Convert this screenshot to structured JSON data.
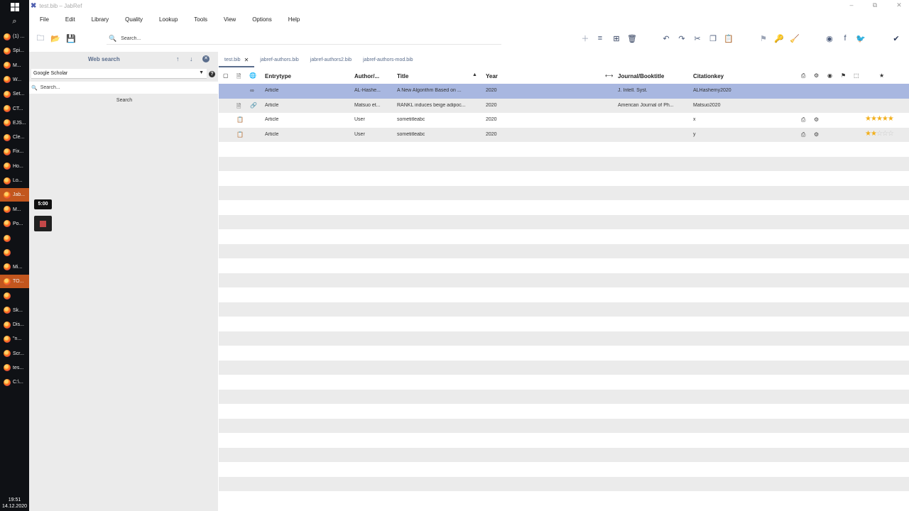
{
  "window": {
    "title": "test.bib – JabRef",
    "app_icon": "jabref-logo-icon"
  },
  "taskbar": {
    "items": [
      {
        "label": "(1) ..."
      },
      {
        "label": "Spi..."
      },
      {
        "label": "M..."
      },
      {
        "label": "W..."
      },
      {
        "label": "Set..."
      },
      {
        "label": "CT..."
      },
      {
        "label": "EJS..."
      },
      {
        "label": "Cle..."
      },
      {
        "label": "Fix..."
      },
      {
        "label": "Ho..."
      },
      {
        "label": "Lo..."
      },
      {
        "label": "Jab..."
      },
      {
        "label": "M..."
      },
      {
        "label": "Po..."
      },
      {
        "label": ""
      },
      {
        "label": ""
      },
      {
        "label": "Mi..."
      },
      {
        "label": "TO..."
      },
      {
        "label": ""
      },
      {
        "label": "Sk..."
      },
      {
        "label": "Dis..."
      },
      {
        "label": "\"n..."
      },
      {
        "label": "Scr..."
      },
      {
        "label": "tes..."
      },
      {
        "label": "C:\\..."
      }
    ],
    "clock_time": "19:51",
    "clock_date": "14.12.2020"
  },
  "menu": {
    "items": [
      "File",
      "Edit",
      "Library",
      "Quality",
      "Lookup",
      "Tools",
      "View",
      "Options",
      "Help"
    ]
  },
  "toolbar": {
    "search_placeholder": "Search..."
  },
  "sidebar": {
    "title": "Web search",
    "engine": "Google Scholar",
    "search_placeholder": "Search...",
    "search_button": "Search"
  },
  "timer": {
    "value": "5:00"
  },
  "tabs": [
    {
      "label": "test.bib",
      "active": true
    },
    {
      "label": "jabref-authors.bib",
      "active": false
    },
    {
      "label": "jabref-authors2.bib",
      "active": false
    },
    {
      "label": "jabref-authors-mod.bib",
      "active": false
    }
  ],
  "table": {
    "columns": {
      "entrytype": "Entrytype",
      "author": "Author/...",
      "title": "Title",
      "year": "Year",
      "journal": "Journal/Booktitle",
      "citationkey": "Citationkey"
    },
    "rows": [
      {
        "entrytype": "Article",
        "author": "AL-Hashe...",
        "title": "A New Algorithm Based on ...",
        "year": "2020",
        "journal": "J. Intell. Syst.",
        "citationkey": "ALHashemy2020",
        "rating": 0
      },
      {
        "entrytype": "Article",
        "author": "Matsuo et...",
        "title": "RANKL induces beige adipoc...",
        "year": "2020",
        "journal": "American Journal of Ph...",
        "citationkey": "Matsuo2020",
        "rating": 0
      },
      {
        "entrytype": "Article",
        "author": "User",
        "title": "sometitleabc",
        "year": "2020",
        "journal": "",
        "citationkey": "x",
        "rating": 5
      },
      {
        "entrytype": "Article",
        "author": "User",
        "title": "sometitleabc",
        "year": "2020",
        "journal": "",
        "citationkey": "y",
        "rating": 2
      }
    ]
  },
  "colors": {
    "selection": "#a8b7e0",
    "accent": "#5a6d8c",
    "star": "#f2b01e"
  }
}
